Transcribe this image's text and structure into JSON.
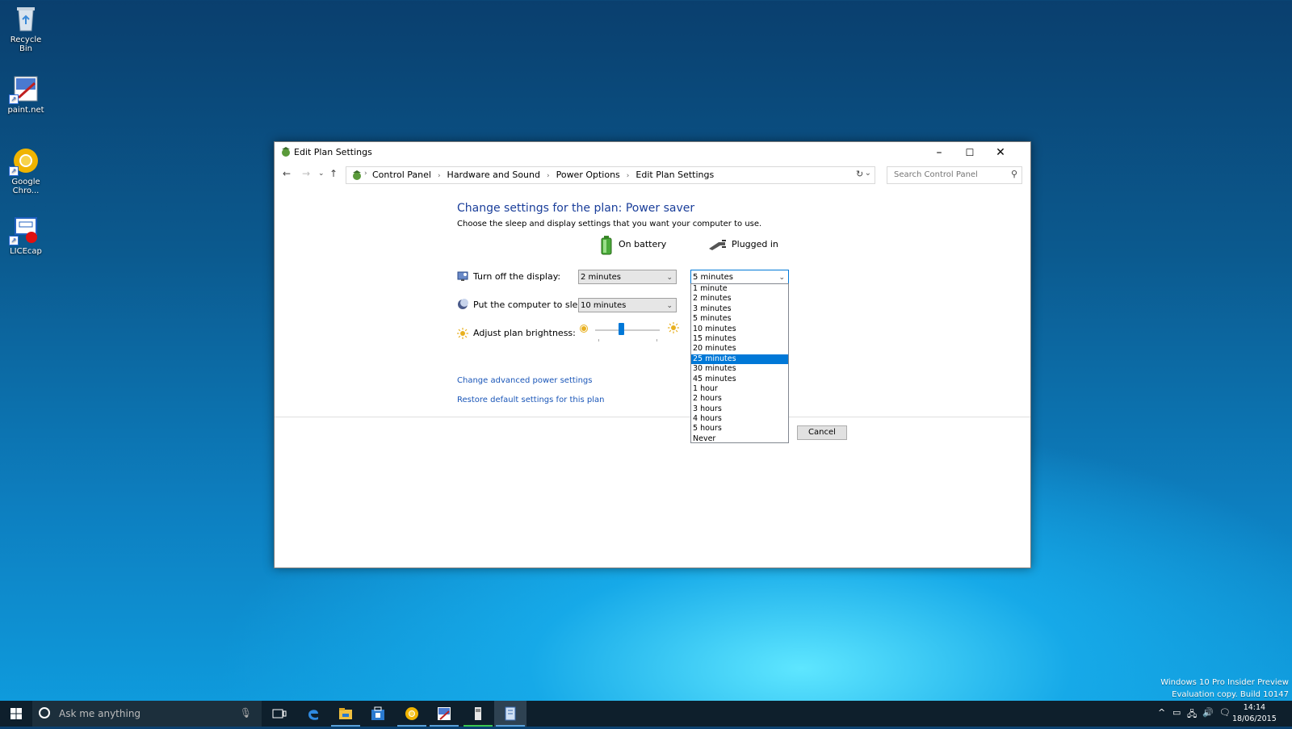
{
  "desktop": {
    "icons": [
      {
        "label": "Recycle Bin"
      },
      {
        "label": "paint.net"
      },
      {
        "label": "Google Chro..."
      },
      {
        "label": "LICEcap"
      }
    ]
  },
  "window": {
    "title": "Edit Plan Settings",
    "controls": {
      "minimize": "–",
      "maximize": "☐",
      "close": "✕"
    },
    "breadcrumb": [
      "Control Panel",
      "Hardware and Sound",
      "Power Options",
      "Edit Plan Settings"
    ],
    "search_placeholder": "Search Control Panel",
    "heading": "Change settings for the plan: Power saver",
    "subheading": "Choose the sleep and display settings that you want your computer to use.",
    "columns": {
      "battery": "On battery",
      "plugged": "Plugged in"
    },
    "rows": {
      "display": {
        "label": "Turn off the display:",
        "battery": "2 minutes",
        "plugged": "5 minutes"
      },
      "sleep": {
        "label": "Put the computer to sleep:",
        "battery": "10 minutes"
      },
      "brightness": {
        "label": "Adjust plan brightness:",
        "level": 0.4
      }
    },
    "dropdown": {
      "options": [
        "1 minute",
        "2 minutes",
        "3 minutes",
        "5 minutes",
        "10 minutes",
        "15 minutes",
        "20 minutes",
        "25 minutes",
        "30 minutes",
        "45 minutes",
        "1 hour",
        "2 hours",
        "3 hours",
        "4 hours",
        "5 hours",
        "Never"
      ],
      "highlighted": "25 minutes"
    },
    "links": {
      "advanced": "Change advanced power settings",
      "restore": "Restore default settings for this plan"
    },
    "cancel_label": "Cancel"
  },
  "taskbar": {
    "search_text": "Ask me anything",
    "time": "14:14",
    "date": "18/06/2015"
  },
  "watermark": {
    "line1": "Windows 10 Pro Insider Preview",
    "line2": "Evaluation copy. Build 10147"
  },
  "colors": {
    "accent": "#0078d7",
    "link": "#1a56b8",
    "heading": "#1a3e9a"
  }
}
